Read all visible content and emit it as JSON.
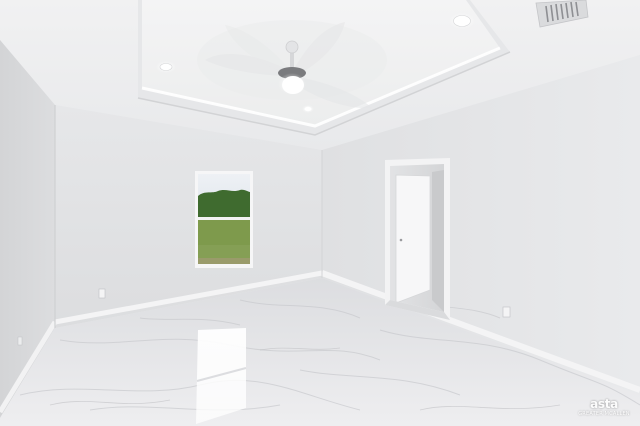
{
  "watermark": {
    "logo_text": "asta",
    "subtitle": "GREATER MCALLEN"
  },
  "colors": {
    "ceiling": "#eeeff1",
    "tray_recess": "#f3f3f4",
    "wall_back": "#e2e3e5",
    "wall_right": "#e4e5e7",
    "wall_left": "#d9dadc",
    "floor": "#e5e6e8",
    "grass": "#7e9a4c",
    "trees": "#3f6b2f",
    "sky": "#e9edf2"
  },
  "icons": {
    "fan": "ceiling-fan-icon",
    "vent": "air-vent-icon",
    "lights": "recessed-light-icon"
  }
}
